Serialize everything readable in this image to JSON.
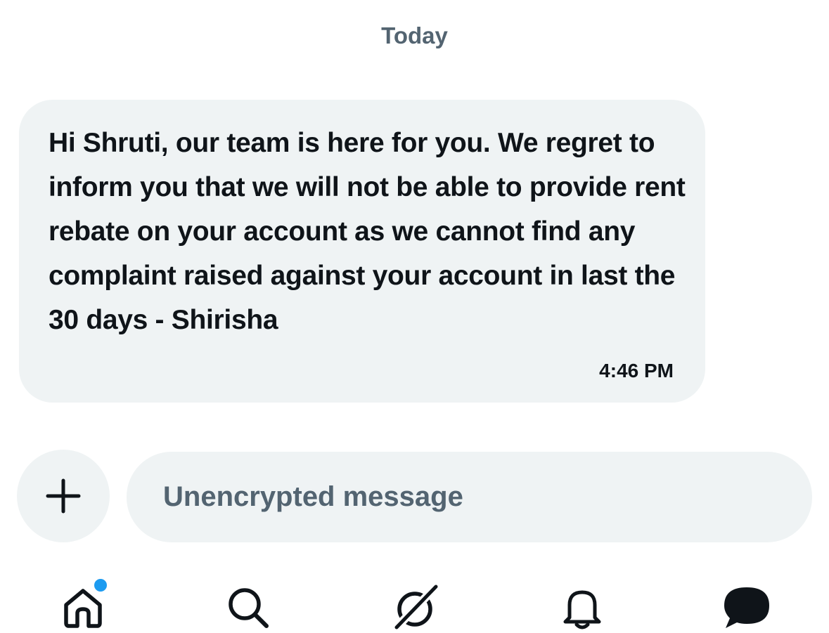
{
  "conversation": {
    "date_separator": "Today",
    "messages": [
      {
        "text": "Hi Shruti, our team is here for you. We regret to inform you that we will not be able to provide rent rebate on your account as we cannot find any complaint raised against your account in last the 30 days - Shirisha",
        "time": "4:46 PM"
      }
    ]
  },
  "composer": {
    "add_icon": "plus-icon",
    "placeholder": "Unencrypted message",
    "value": ""
  },
  "tabbar": {
    "items": [
      {
        "icon": "home-icon",
        "has_badge": true
      },
      {
        "icon": "search-icon"
      },
      {
        "icon": "grok-icon"
      },
      {
        "icon": "bell-icon"
      },
      {
        "icon": "messages-icon",
        "active": true
      }
    ],
    "badge_color": "#1d9bf0"
  },
  "colors": {
    "bubble_bg": "#eff3f4",
    "text_primary": "#0f1419",
    "text_secondary": "#536471"
  }
}
